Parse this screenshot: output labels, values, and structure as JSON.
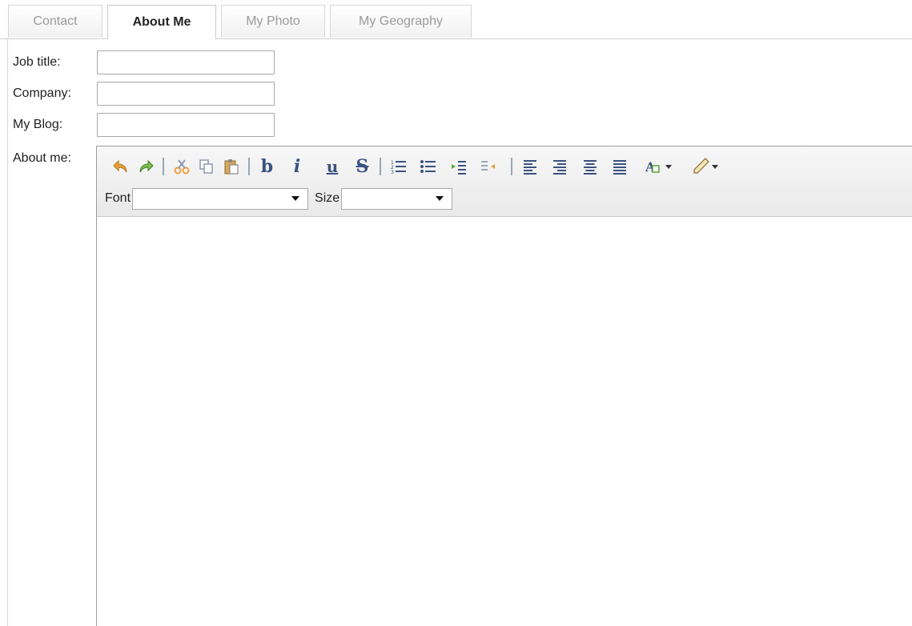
{
  "tabs": [
    {
      "label": "Contact",
      "active": false
    },
    {
      "label": "About Me",
      "active": true
    },
    {
      "label": "My Photo",
      "active": false
    },
    {
      "label": "My Geography",
      "active": false
    }
  ],
  "form": {
    "job_title_label": "Job title:",
    "job_title_value": "",
    "company_label": "Company:",
    "company_value": "",
    "blog_label": "My Blog:",
    "blog_value": "",
    "about_label": "About me:"
  },
  "editor": {
    "font_label": "Font",
    "font_value": "",
    "size_label": "Size",
    "size_value": "",
    "content": "",
    "toolbar_icons": [
      "undo-icon",
      "redo-icon",
      "cut-icon",
      "copy-icon",
      "paste-icon",
      "bold-icon",
      "italic-icon",
      "underline-icon",
      "strikethrough-icon",
      "ordered-list-icon",
      "unordered-list-icon",
      "indent-icon",
      "outdent-icon",
      "align-left-icon",
      "align-right-icon",
      "align-center-icon",
      "align-justify-icon",
      "text-color-icon",
      "highlight-icon"
    ]
  },
  "colors": {
    "toolbar_icon": "#4a5f80",
    "undo_orange": "#e8a33a",
    "redo_green": "#5aa33a",
    "tab_border": "#d6d6d6"
  }
}
